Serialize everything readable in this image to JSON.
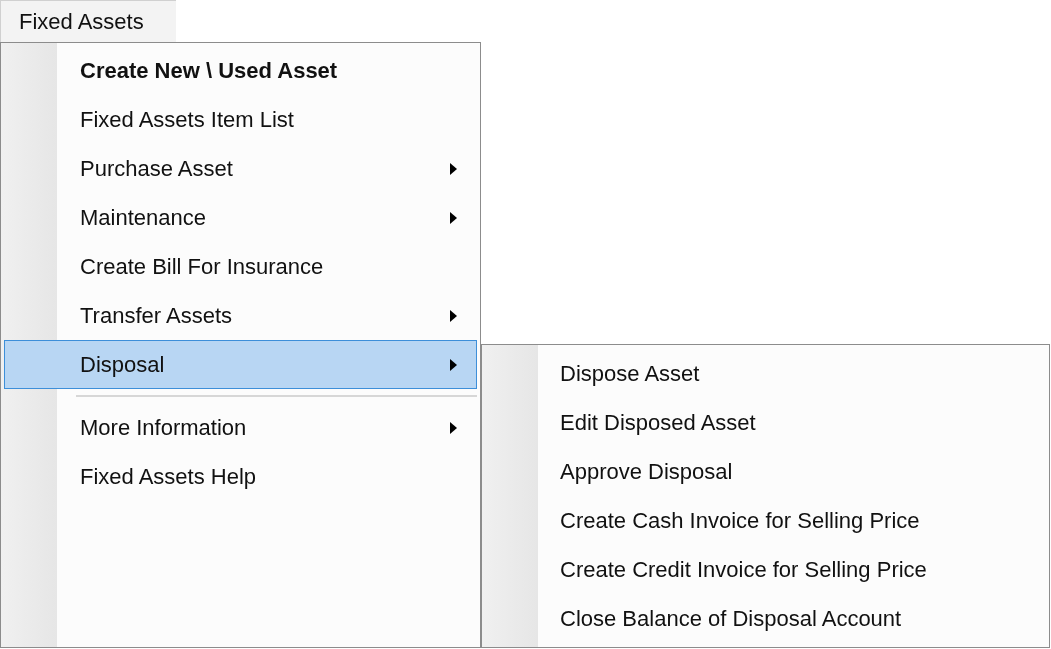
{
  "menu_bar": {
    "title": "Fixed Assets"
  },
  "menu": {
    "items": [
      {
        "kind": "item",
        "label": "Create New \\ Used Asset",
        "default": true,
        "has_submenu": false,
        "selected": false
      },
      {
        "kind": "item",
        "label": "Fixed Assets Item List",
        "default": false,
        "has_submenu": false,
        "selected": false
      },
      {
        "kind": "item",
        "label": "Purchase Asset",
        "default": false,
        "has_submenu": true,
        "selected": false
      },
      {
        "kind": "item",
        "label": "Maintenance",
        "default": false,
        "has_submenu": true,
        "selected": false
      },
      {
        "kind": "item",
        "label": "Create Bill For Insurance",
        "default": false,
        "has_submenu": false,
        "selected": false
      },
      {
        "kind": "item",
        "label": "Transfer Assets",
        "default": false,
        "has_submenu": true,
        "selected": false
      },
      {
        "kind": "item",
        "label": "Disposal",
        "default": false,
        "has_submenu": true,
        "selected": true
      },
      {
        "kind": "separator"
      },
      {
        "kind": "item",
        "label": "More Information",
        "default": false,
        "has_submenu": true,
        "selected": false
      },
      {
        "kind": "item",
        "label": "Fixed Assets Help",
        "default": false,
        "has_submenu": false,
        "selected": false
      }
    ]
  },
  "submenu": {
    "items": [
      {
        "label": "Dispose Asset",
        "selected": false
      },
      {
        "label": "Edit Disposed Asset",
        "selected": false
      },
      {
        "label": "Approve Disposal",
        "selected": false
      },
      {
        "label": "Create Cash Invoice for Selling Price",
        "selected": false
      },
      {
        "label": "Create Credit Invoice for Selling Price",
        "selected": false
      },
      {
        "label": "Close Balance of Disposal Account",
        "selected": false
      }
    ]
  }
}
